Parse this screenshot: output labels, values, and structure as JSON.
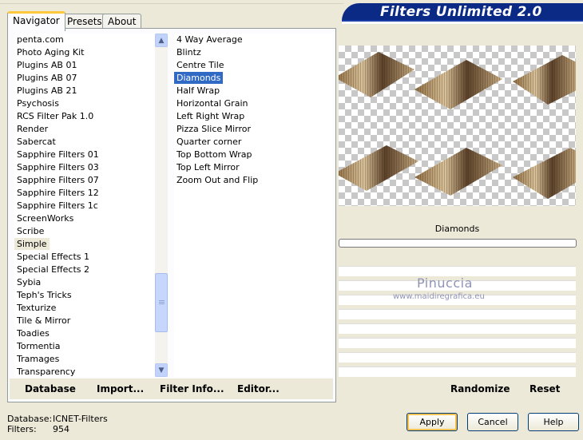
{
  "header": {
    "title": "Filters Unlimited 2.0"
  },
  "tabs": [
    {
      "label": "Navigator",
      "active": true
    },
    {
      "label": "Presets",
      "active": false
    },
    {
      "label": "About",
      "active": false
    }
  ],
  "categories": {
    "items": [
      "penta.com",
      "Photo Aging Kit",
      "Plugins AB 01",
      "Plugins AB 07",
      "Plugins AB 21",
      "Psychosis",
      "RCS Filter Pak 1.0",
      "Render",
      "Sabercat",
      "Sapphire Filters 01",
      "Sapphire Filters 03",
      "Sapphire Filters 07",
      "Sapphire Filters 12",
      "Sapphire Filters 1c",
      "ScreenWorks",
      "Scribe",
      "Simple",
      "Special Effects 1",
      "Special Effects 2",
      "Sybia",
      "Teph's Tricks",
      "Texturize",
      "Tile & Mirror",
      "Toadies",
      "Tormentia",
      "Tramages",
      "Transparency"
    ],
    "selected": "Simple"
  },
  "filters": {
    "items": [
      "4 Way Average",
      "Blintz",
      "Centre Tile",
      "Diamonds",
      "Half Wrap",
      "Horizontal Grain",
      "Left Right Wrap",
      "Pizza Slice Mirror",
      "Quarter corner",
      "Top Bottom Wrap",
      "Top Left Mirror",
      "Zoom Out and Flip"
    ],
    "selected": "Diamonds"
  },
  "links": {
    "database": "Database",
    "import": "Import...",
    "filter_info": "Filter Info...",
    "editor": "Editor..."
  },
  "preview": {
    "filter_name": "Diamonds",
    "progress": 0
  },
  "watermark": {
    "name": "Pinuccia",
    "url": "www.maidiregrafica.eu"
  },
  "actions": {
    "randomize": "Randomize",
    "reset": "Reset"
  },
  "status": {
    "database_label": "Database:",
    "database_value": "ICNET-Filters",
    "filters_label": "Filters:",
    "filters_value": "954"
  },
  "buttons": {
    "apply": "Apply",
    "cancel": "Cancel",
    "help": "Help"
  },
  "colors": {
    "selection": "#316ac5",
    "banner": "#0a2a86"
  }
}
